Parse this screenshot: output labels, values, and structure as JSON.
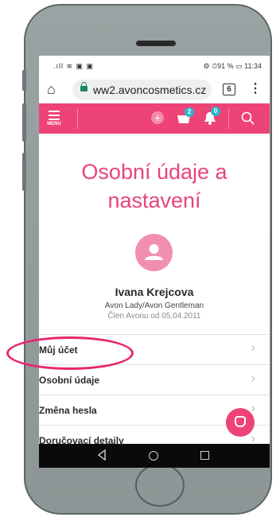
{
  "status_bar": {
    "signal": ".ıll ≋ ▣ ▣",
    "right": "⚙ ⏱91 % ▭ 11:34"
  },
  "browser": {
    "url": "ww2.avoncosmetics.cz",
    "tab_count": "6",
    "menu_glyph": "⋮",
    "home_glyph": "⌂"
  },
  "app_bar": {
    "menu_label": "MENU",
    "plus_glyph": "+",
    "cart_badge": "2",
    "notification_badge": "0"
  },
  "page": {
    "title_line1": "Osobní údaje a",
    "title_line2": "nastavení"
  },
  "profile": {
    "name": "Ivana Krejcova",
    "role": "Avon Lady/Avon Gentleman",
    "member_since": "Člen Avonu od 05.04.2011"
  },
  "menu_items": [
    {
      "label": "Můj účet"
    },
    {
      "label": "Osobní údaje"
    },
    {
      "label": "Změna hesla"
    },
    {
      "label": "Doručovací detaily"
    }
  ],
  "chevron": "›",
  "colors": {
    "accent": "#ee4377",
    "title": "#e8457a",
    "badge": "#29b7c9",
    "annotation": "#e8266f"
  }
}
